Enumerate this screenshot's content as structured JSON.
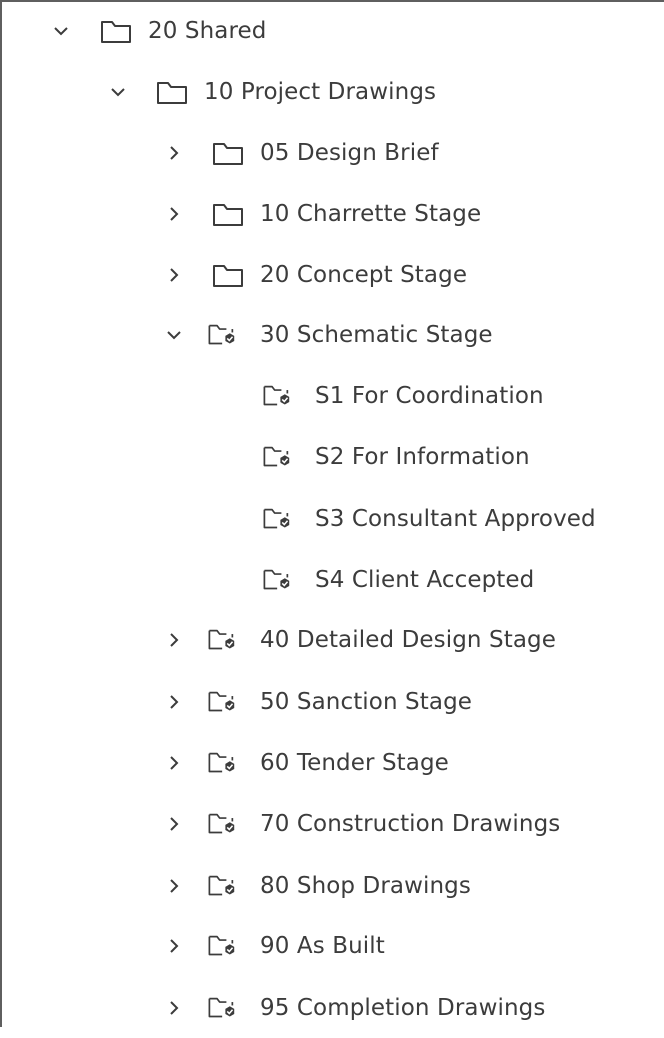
{
  "tree": {
    "root": {
      "label": "20 Shared",
      "expanded": true,
      "icon": "folder-icon"
    },
    "project": {
      "label": "10 Project Drawings",
      "expanded": true,
      "icon": "folder-icon"
    },
    "stages": [
      {
        "label": "05 Design Brief",
        "expanded": false,
        "icon": "folder-icon"
      },
      {
        "label": "10 Charrette Stage",
        "expanded": false,
        "icon": "folder-icon"
      },
      {
        "label": "20 Concept Stage",
        "expanded": false,
        "icon": "folder-icon"
      },
      {
        "label": "30 Schematic Stage",
        "expanded": true,
        "icon": "controlled-folder-icon",
        "children": [
          {
            "label": "S1 For Coordination",
            "icon": "controlled-folder-icon"
          },
          {
            "label": "S2 For Information",
            "icon": "controlled-folder-icon"
          },
          {
            "label": "S3 Consultant Approved",
            "icon": "controlled-folder-icon"
          },
          {
            "label": "S4 Client Accepted",
            "icon": "controlled-folder-icon"
          }
        ]
      },
      {
        "label": "40 Detailed Design Stage",
        "expanded": false,
        "icon": "controlled-folder-icon"
      },
      {
        "label": "50 Sanction Stage",
        "expanded": false,
        "icon": "controlled-folder-icon"
      },
      {
        "label": "60 Tender Stage",
        "expanded": false,
        "icon": "controlled-folder-icon"
      },
      {
        "label": "70 Construction Drawings",
        "expanded": false,
        "icon": "controlled-folder-icon"
      },
      {
        "label": "80 Shop Drawings",
        "expanded": false,
        "icon": "controlled-folder-icon"
      },
      {
        "label": "90 As Built",
        "expanded": false,
        "icon": "controlled-folder-icon"
      },
      {
        "label": "95 Completion Drawings",
        "expanded": false,
        "icon": "controlled-folder-icon"
      }
    ]
  },
  "colors": {
    "text": "#3c3c3c",
    "icon_stroke": "#3c3c3c",
    "border": "#5f5f5f",
    "background": "#ffffff"
  }
}
